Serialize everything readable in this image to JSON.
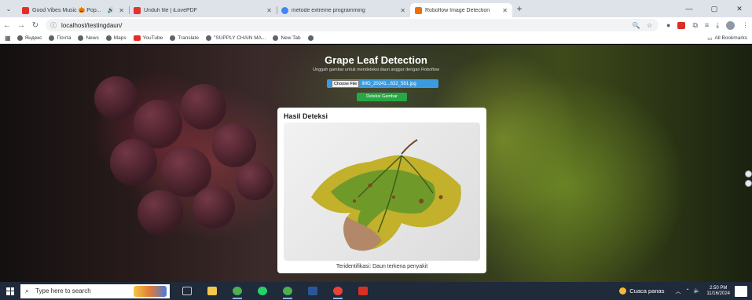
{
  "browser": {
    "tabs": [
      {
        "label": "Good Vibes Music 🎃 Pop...",
        "favicon_color": "#e52d27",
        "active": false
      },
      {
        "label": "Unduh file | iLovePDF",
        "favicon_color": "#e5322d",
        "active": false
      },
      {
        "label": "metode extreme programming",
        "favicon_color": "#4285f4",
        "active": false
      },
      {
        "label": "Roboflow Image Detection",
        "favicon_color": "#e8710a",
        "active": true
      }
    ],
    "new_tab_label": "+",
    "url": "localhost/testingdaun/",
    "bookmarks": [
      {
        "label": "Яндекс"
      },
      {
        "label": "Почта"
      },
      {
        "label": "News"
      },
      {
        "label": "Maps"
      },
      {
        "label": "YouTube"
      },
      {
        "label": "Translate"
      },
      {
        "label": "\"SUPPLY CHAIN MA..."
      },
      {
        "label": "New Tab"
      },
      {
        "label": ""
      }
    ],
    "all_bookmarks_label": "All Bookmarks"
  },
  "app": {
    "title": "Grape Leaf Detection",
    "subtitle": "Unggah gambar untuk mendeteksi daun anggur dengan Roboflow",
    "choose_file_label": "Choose File",
    "file_name": "IMG_20241...632_581.jpg",
    "detect_button": "Deteksi Gambar",
    "result": {
      "title": "Hasil Deteksi",
      "caption": "Teridentifikasi: Daun terkena penyakit"
    }
  },
  "taskbar": {
    "search_placeholder": "Type here to search",
    "weather": "Cuaca panas",
    "time": "2:50 PM",
    "date": "11/16/2024"
  },
  "colors": {
    "accent_blue": "#3b9be0",
    "detect_green": "#28a745",
    "taskbar": "#1f2a3a"
  }
}
